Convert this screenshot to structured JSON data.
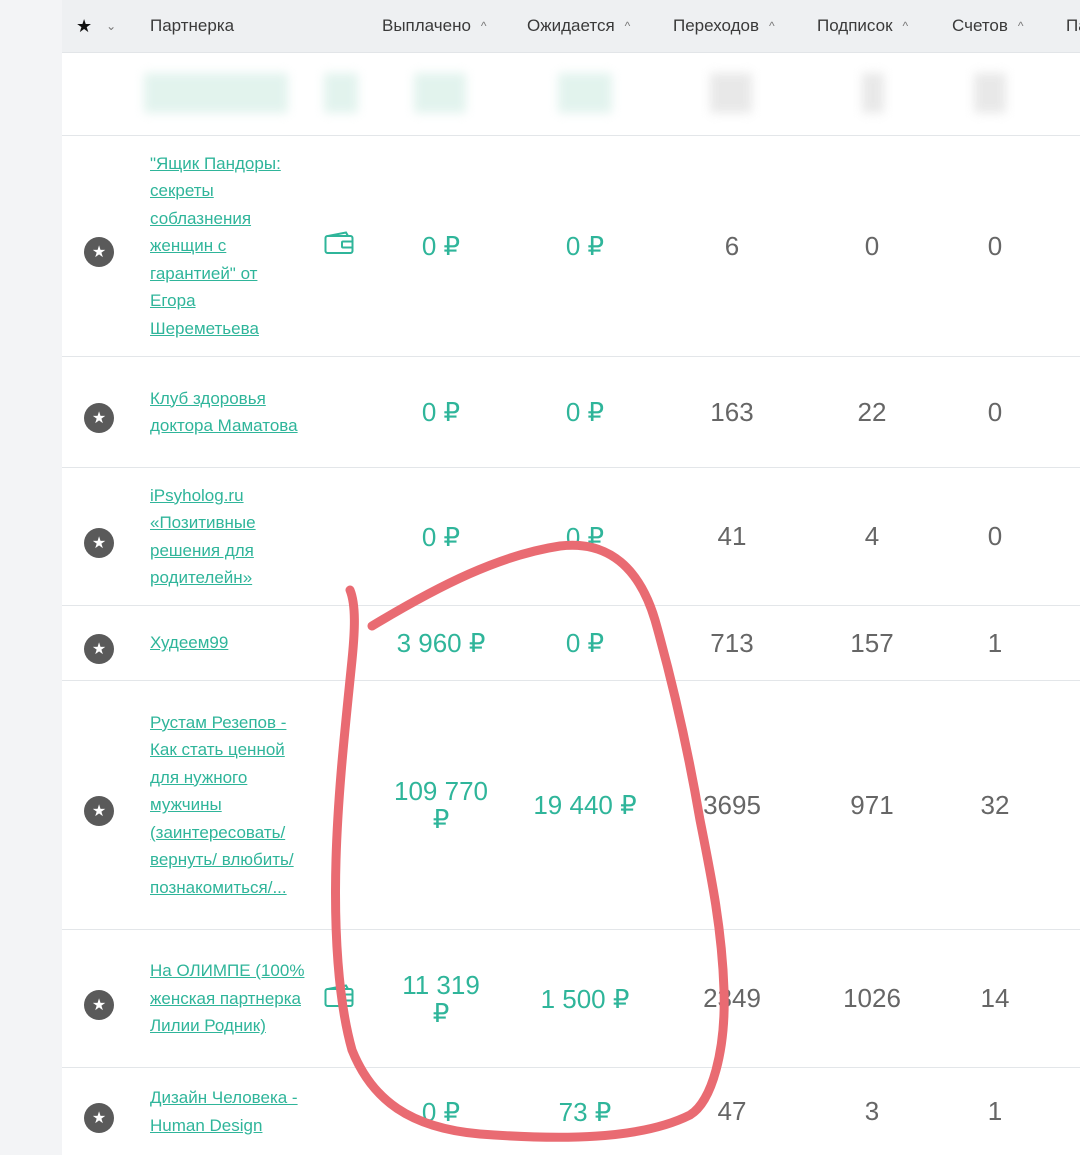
{
  "header": {
    "star_icon": "star-icon",
    "partner_label": "Партнерка",
    "paid_label": "Выплачено",
    "expected_label": "Ожидается",
    "clicks_label": "Переходов",
    "subs_label": "Подписок",
    "invoices_label": "Счетов",
    "next_label": "Па"
  },
  "rows": [
    {
      "name": "\"Ящик Пандоры: секреты соблазнения женщин с гарантией\" от Егора Шереметьева",
      "paid": "0 ₽",
      "expected": "0 ₽",
      "clicks": "6",
      "subs": "0",
      "invoices": "0",
      "wallet": true
    },
    {
      "name": "Клуб здоровья доктора Маматова",
      "paid": "0 ₽",
      "expected": "0 ₽",
      "clicks": "163",
      "subs": "22",
      "invoices": "0",
      "wallet": false
    },
    {
      "name": "iPsyholog.ru «Позитивные решения для родителейн»",
      "paid": "0 ₽",
      "expected": "0 ₽",
      "clicks": "41",
      "subs": "4",
      "invoices": "0",
      "wallet": false
    },
    {
      "name": "Худеем99",
      "paid": "3 960 ₽",
      "expected": "0 ₽",
      "clicks": "713",
      "subs": "157",
      "invoices": "1",
      "wallet": false
    },
    {
      "name": "Рустам Резепов - Как стать ценной для нужного мужчины (заинтересовать/ вернуть/ влюбить/ познакомиться/...",
      "paid": "109 770 ₽",
      "expected": "19 440 ₽",
      "clicks": "3695",
      "subs": "971",
      "invoices": "32",
      "wallet": false
    },
    {
      "name": "На ОЛИМПЕ (100% женская партнерка Лилии Родник)",
      "paid": "11 319 ₽",
      "expected": "1 500 ₽",
      "clicks": "2349",
      "subs": "1026",
      "invoices": "14",
      "wallet": true
    },
    {
      "name": "Дизайн Человека - Human Design",
      "paid": "0 ₽",
      "expected": "73 ₽",
      "clicks": "47",
      "subs": "3",
      "invoices": "1",
      "wallet": false
    }
  ],
  "colors": {
    "accent": "#2fb59a",
    "annotation": "#e96b72"
  }
}
